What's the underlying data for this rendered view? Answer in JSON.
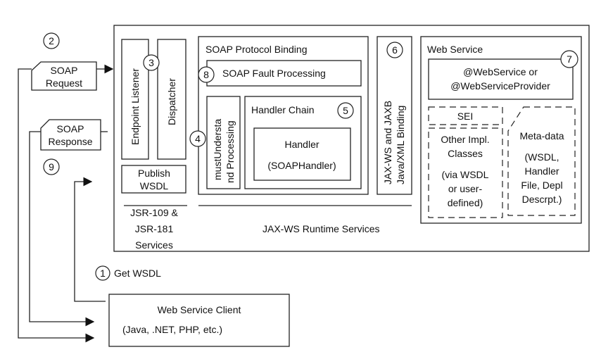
{
  "soap_request": [
    "SOAP",
    "Request"
  ],
  "soap_response": [
    "SOAP",
    "Response"
  ],
  "endpoint_listener": "Endpoint Listener",
  "dispatcher": "Dispatcher",
  "publish_wsdl": [
    "Publish",
    "WSDL"
  ],
  "jsr_services": [
    "JSR-109 &",
    "JSR-181",
    "Services"
  ],
  "soap_protocol_binding": "SOAP Protocol Binding",
  "soap_fault_processing": "SOAP Fault Processing",
  "must_understand": [
    "mustUndersta",
    "nd Processing"
  ],
  "handler_chain": "Handler Chain",
  "handler": [
    "Handler",
    "(SOAPHandler)"
  ],
  "jaxws_jaxb": [
    "JAX-WS and JAXB",
    "Java/XML Binding"
  ],
  "runtime_services": "JAX-WS Runtime Services",
  "web_service": "Web Service",
  "annotation": [
    "@WebService or",
    "@WebServiceProvider"
  ],
  "sei": "SEI",
  "other_impl": [
    "Other Impl.",
    "Classes",
    "(via WSDL",
    "or user-",
    "defined)"
  ],
  "metadata": [
    "Meta-data",
    "(WSDL,",
    "Handler",
    "File, Depl",
    "Descrpt.)"
  ],
  "get_wsdl": "Get WSDL",
  "client": [
    "Web Service Client",
    "(Java, .NET, PHP, etc.)"
  ],
  "steps": [
    "1",
    "2",
    "3",
    "4",
    "5",
    "6",
    "7",
    "8",
    "9"
  ]
}
